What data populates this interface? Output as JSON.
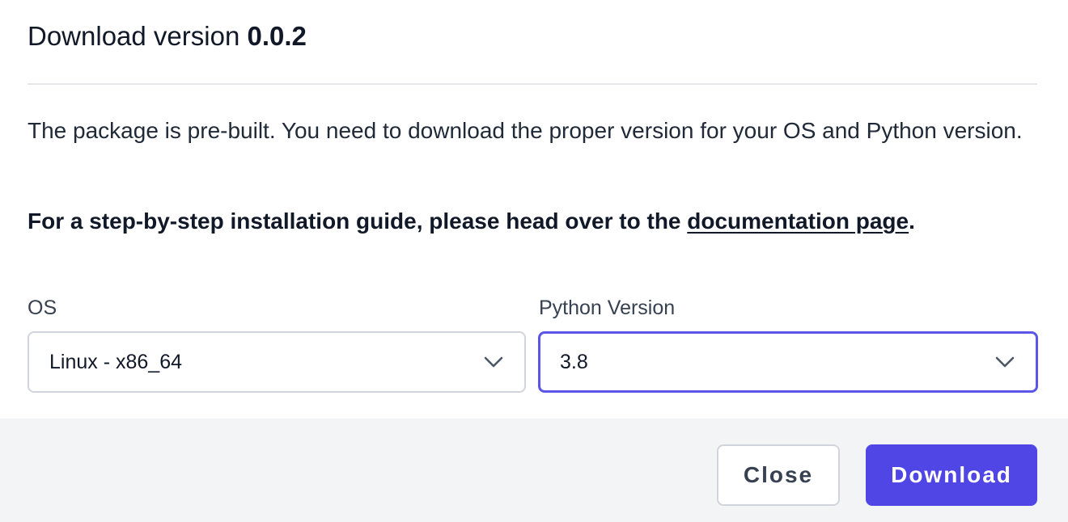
{
  "dialog": {
    "title_prefix": "Download version ",
    "title_version": "0.0.2",
    "description": "The package is pre-built. You need to download the proper version for your OS and Python version.",
    "guide_prefix": "For a step-by-step installation guide, please head over to the ",
    "guide_link": "documentation page",
    "guide_suffix": "."
  },
  "form": {
    "os": {
      "label": "OS",
      "value": "Linux - x86_64",
      "icon": "chevron-down-icon"
    },
    "python": {
      "label": "Python Version",
      "value": "3.8",
      "icon": "chevron-down-icon",
      "focused": true
    }
  },
  "footer": {
    "close_label": "Close",
    "download_label": "Download"
  },
  "colors": {
    "accent": "#4f46e5",
    "focus_ring": "#5b55e8",
    "footer_bg": "#f3f4f6"
  }
}
